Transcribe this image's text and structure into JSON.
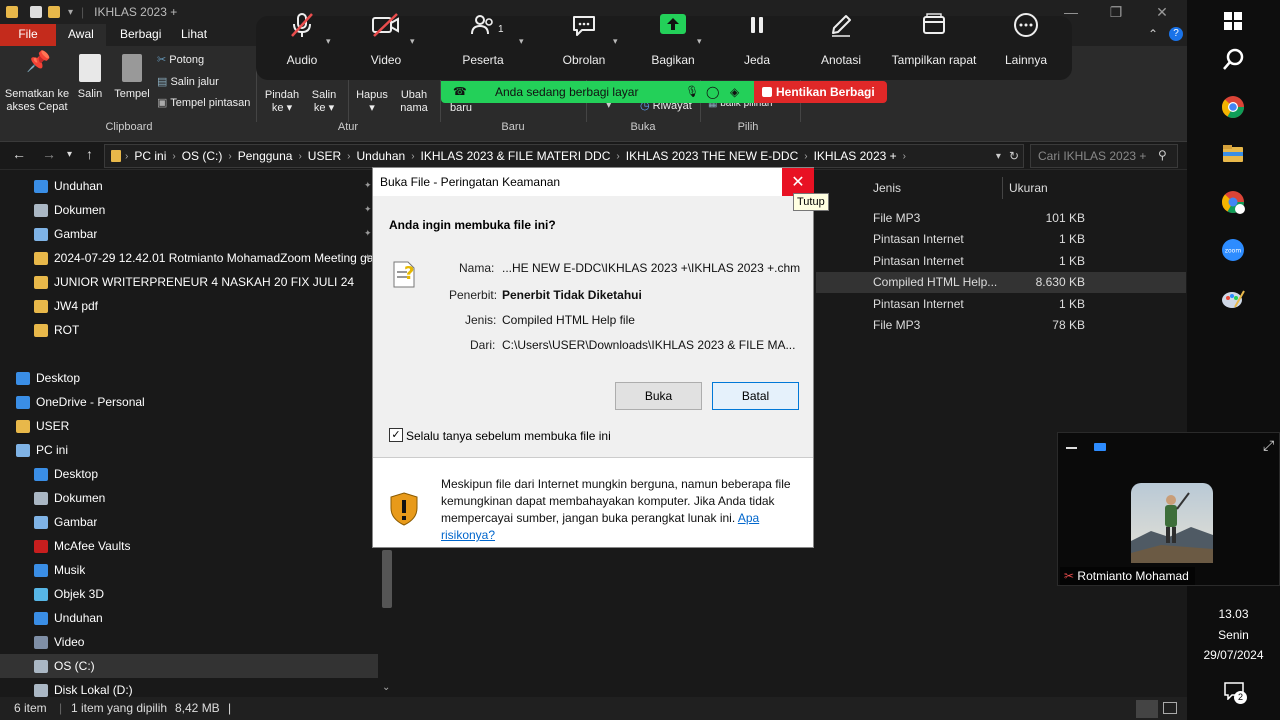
{
  "explorer": {
    "title": "IKHLAS 2023 +",
    "tabs": [
      "File",
      "Awal",
      "Berbagi",
      "Lihat"
    ],
    "ribbon": {
      "pin_label": "Sematkan ke akses Cepat",
      "copy_label": "Salin",
      "paste_label": "Tempel",
      "cut_label": "Potong",
      "copy_path_label": "Salin jalur",
      "paste_shortcut_label": "Tempel pintasan",
      "move_label": "Pindah ke",
      "copy_to_label": "Salin ke",
      "delete_label": "Hapus",
      "rename_label": "Ubah nama",
      "new_label": "baru",
      "history_label": "Riwayat",
      "invert_label": "balik pilihan",
      "groups": [
        "Clipboard",
        "Atur",
        "Baru",
        "Buka",
        "Pilih"
      ]
    },
    "breadcrumbs": [
      "PC ini",
      "OS (C:)",
      "Pengguna",
      "USER",
      "Unduhan",
      "IKHLAS 2023 & FILE MATERI DDC",
      "IKHLAS 2023 THE NEW E-DDC",
      "IKHLAS 2023 +"
    ],
    "search_placeholder": "Cari IKHLAS 2023 +",
    "nav_items": [
      {
        "label": "Unduhan",
        "indent": 1,
        "icon": "download-icon"
      },
      {
        "label": "Dokumen",
        "indent": 1,
        "icon": "document-icon"
      },
      {
        "label": "Gambar",
        "indent": 1,
        "icon": "picture-icon"
      },
      {
        "label": "2024-07-29 12.42.01 Rotmianto MohamadZoom Meeting ga",
        "indent": 1,
        "icon": "folder-icon"
      },
      {
        "label": "JUNIOR WRITERPRENEUR 4 NASKAH 20 FIX JULI 24",
        "indent": 1,
        "icon": "folder-icon"
      },
      {
        "label": "JW4 pdf",
        "indent": 1,
        "icon": "folder-icon"
      },
      {
        "label": "ROT",
        "indent": 1,
        "icon": "folder-icon"
      },
      {
        "label": "",
        "indent": 0,
        "icon": ""
      },
      {
        "label": "Desktop",
        "indent": 0,
        "icon": "desktop-icon"
      },
      {
        "label": "OneDrive - Personal",
        "indent": 0,
        "icon": "cloud-icon"
      },
      {
        "label": "USER",
        "indent": 0,
        "icon": "user-folder-icon"
      },
      {
        "label": "PC ini",
        "indent": 0,
        "icon": "pc-icon"
      },
      {
        "label": "Desktop",
        "indent": 1,
        "icon": "desktop-icon"
      },
      {
        "label": "Dokumen",
        "indent": 1,
        "icon": "document-icon"
      },
      {
        "label": "Gambar",
        "indent": 1,
        "icon": "picture-icon"
      },
      {
        "label": "McAfee Vaults",
        "indent": 1,
        "icon": "mcafee-icon"
      },
      {
        "label": "Musik",
        "indent": 1,
        "icon": "music-icon"
      },
      {
        "label": "Objek 3D",
        "indent": 1,
        "icon": "cube-icon"
      },
      {
        "label": "Unduhan",
        "indent": 1,
        "icon": "download-icon"
      },
      {
        "label": "Video",
        "indent": 1,
        "icon": "video-icon"
      },
      {
        "label": "OS (C:)",
        "indent": 1,
        "icon": "drive-icon"
      },
      {
        "label": "Disk Lokal (D:)",
        "indent": 1,
        "icon": "drive-icon"
      }
    ],
    "columns": {
      "type": "Jenis",
      "size": "Ukuran"
    },
    "files": [
      {
        "type": "File MP3",
        "size": "101 KB"
      },
      {
        "type": "Pintasan Internet",
        "size": "1 KB"
      },
      {
        "type": "Pintasan Internet",
        "size": "1 KB"
      },
      {
        "type": "Compiled HTML Help...",
        "size": "8.630 KB"
      },
      {
        "type": "Pintasan Internet",
        "size": "1 KB"
      },
      {
        "type": "File MP3",
        "size": "78 KB"
      }
    ],
    "status": {
      "count": "6 item",
      "selected": "1 item yang dipilih",
      "size": "8,42 MB"
    }
  },
  "zoom": {
    "controls": [
      {
        "label": "Audio",
        "icon": "mic-muted-icon"
      },
      {
        "label": "Video",
        "icon": "video-off-icon"
      },
      {
        "label": "Peserta",
        "icon": "participants-icon",
        "badge": "1"
      },
      {
        "label": "Obrolan",
        "icon": "chat-icon"
      },
      {
        "label": "Bagikan",
        "icon": "share-screen-icon"
      },
      {
        "label": "Jeda",
        "icon": "pause-icon"
      },
      {
        "label": "Anotasi",
        "icon": "pencil-icon"
      },
      {
        "label": "Tampilkan rapat",
        "icon": "window-icon"
      },
      {
        "label": "Lainnya",
        "icon": "more-icon"
      }
    ],
    "sharing_text": "Anda sedang berbagi layar",
    "stop_share_label": "Hentikan Berbagi",
    "participant_name": "Rotmianto Mohamad"
  },
  "dialog": {
    "title": "Buka File - Peringatan Keamanan",
    "close_tooltip": "Tutup",
    "question": "Anda ingin membuka file ini?",
    "fields": [
      {
        "label": "Nama:",
        "value": "...HE NEW E-DDC\\IKHLAS 2023 +\\IKHLAS 2023 +.chm"
      },
      {
        "label": "Penerbit:",
        "value": "Penerbit Tidak Diketahui"
      },
      {
        "label": "Jenis:",
        "value": "Compiled HTML Help file"
      },
      {
        "label": "Dari:",
        "value": "C:\\Users\\USER\\Downloads\\IKHLAS 2023 & FILE MA..."
      }
    ],
    "open_label": "Buka",
    "cancel_label": "Batal",
    "checkbox_label": "Selalu tanya sebelum membuka file ini",
    "checkbox_checked": true,
    "warning_text": "Meskipun file dari Internet mungkin berguna, namun beberapa file kemungkinan dapat membahayakan komputer. Jika Anda tidak mempercayai sumber, jangan buka perangkat lunak ini.",
    "risk_link": "Apa risikonya?"
  },
  "taskbar": {
    "time": "13.03",
    "day": "Senin",
    "date": "29/07/2024",
    "notif_count": "2"
  }
}
